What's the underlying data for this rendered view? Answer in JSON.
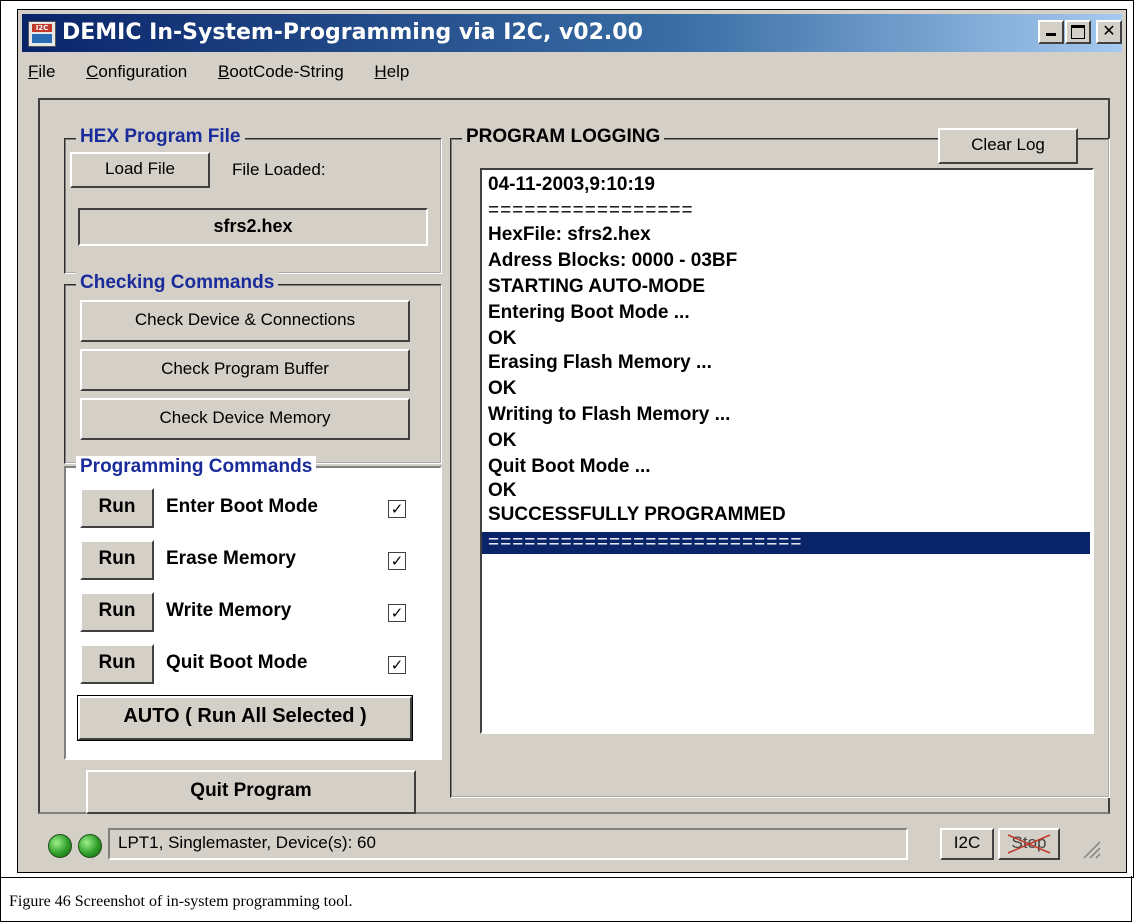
{
  "window": {
    "title": "DEMIC In-System-Programming via I2C,  v02.00",
    "icon_label": "I2C",
    "caption_buttons": [
      "minimize",
      "maximize",
      "close"
    ]
  },
  "menu": {
    "items": [
      "File",
      "Configuration",
      "BootCode-String",
      "Help"
    ],
    "mnemonics": [
      "F",
      "C",
      "B",
      "H"
    ]
  },
  "hex_group": {
    "title": "HEX Program File",
    "load_button": "Load File",
    "loaded_label": "File Loaded:",
    "file_name": "sfrs2.hex"
  },
  "checking_group": {
    "title": "Checking Commands",
    "buttons": [
      "Check Device & Connections",
      "Check Program Buffer",
      "Check Device Memory"
    ]
  },
  "programming_group": {
    "title": "Programming Commands",
    "run_label": "Run",
    "commands": [
      {
        "label": "Enter Boot Mode",
        "checked": true
      },
      {
        "label": "Erase Memory",
        "checked": true
      },
      {
        "label": "Write Memory",
        "checked": true
      },
      {
        "label": "Quit Boot Mode",
        "checked": true
      }
    ],
    "auto_button": "AUTO ( Run All Selected )"
  },
  "quit_button": "Quit Program",
  "logging": {
    "title": "PROGRAM LOGGING",
    "clear_button": "Clear Log",
    "lines": [
      "04-11-2003,9:10:19",
      "=================",
      "HexFile: sfrs2.hex",
      "Adress Blocks: 0000 - 03BF",
      "STARTING AUTO-MODE",
      "Entering Boot Mode ...",
      "OK",
      "Erasing Flash Memory ...",
      "OK",
      "Writing to Flash Memory ...",
      "OK",
      "Quit Boot Mode ...",
      "OK",
      "SUCCESSFULLY PROGRAMMED",
      "=========================="
    ],
    "selected_line": 14
  },
  "status": {
    "text": "LPT1, Singlemaster, Device(s): 60",
    "i2c_button": "I2C",
    "stop_button": "Stop",
    "led_color": "#2e9e28"
  },
  "caption": "Figure 46 Screenshot of in-system programming tool.",
  "colors": {
    "title_start": "#0a246a",
    "title_end": "#a6caf0",
    "group_title": "#1a2b9a",
    "face": "#d4d0c8",
    "selection": "#0a246a"
  }
}
